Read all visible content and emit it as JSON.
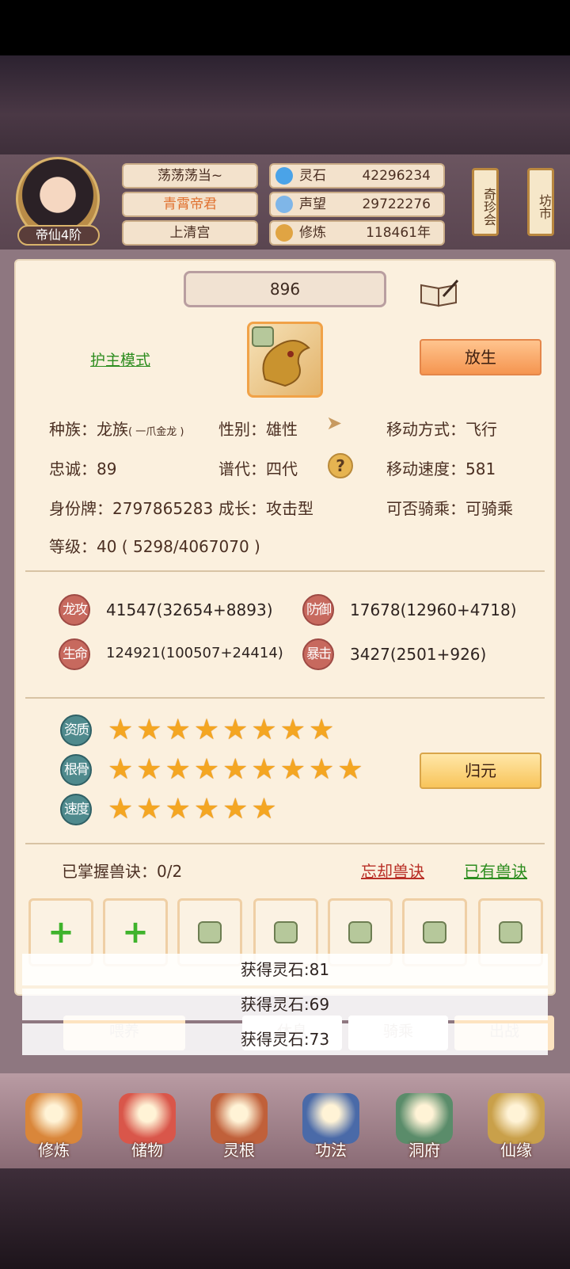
{
  "header": {
    "avatar_level": "帝仙4阶",
    "player_name": "荡荡荡当~",
    "player_title": "青霄帝君",
    "sect": "上清宫",
    "resources": [
      {
        "icon": "spirit-stone-icon",
        "label": "灵石",
        "value": "42296234"
      },
      {
        "icon": "reputation-icon",
        "label": "声望",
        "value": "29722276"
      },
      {
        "icon": "cultivation-icon",
        "label": "修炼",
        "value": "118461年"
      }
    ],
    "side_buttons": [
      {
        "label": "奇珍会"
      },
      {
        "label": "坊市"
      }
    ]
  },
  "pet": {
    "number": "896",
    "guard_mode_label": "护主模式",
    "release_label": "放生",
    "race_label": "种族：龙族",
    "race_sub": "( 一爪金龙 )",
    "gender": "性别：雄性",
    "movement": "移动方式：飞行",
    "loyalty": "忠诚：89",
    "generation": "谱代：四代",
    "move_speed": "移动速度：581",
    "id_tag": "身份牌：2797865283",
    "growth": "成长：攻击型",
    "rideable": "可否骑乘：可骑乘",
    "level": "等级：40 ( 5298/4067070 )"
  },
  "stats": [
    {
      "badge": "龙攻",
      "value": "41547(32654+8893)"
    },
    {
      "badge": "防御",
      "value": "17678(12960+4718)"
    },
    {
      "badge": "生命",
      "value": "124921(100507+24414)"
    },
    {
      "badge": "暴击",
      "value": "3427(2501+926)"
    }
  ],
  "aptitude": {
    "rows": [
      {
        "badge": "资质",
        "stars": 8
      },
      {
        "badge": "根骨",
        "stars": 9
      },
      {
        "badge": "速度",
        "stars": 6
      }
    ],
    "restore_label": "归元"
  },
  "skills": {
    "mastered": "已掌握兽诀：0/2",
    "forget_label": "忘却兽诀",
    "owned_label": "已有兽诀"
  },
  "gains": [
    "获得灵石:81",
    "获得灵石:69",
    "获得灵石:73"
  ],
  "actions": [
    "喂养",
    "休息",
    "骑乘",
    "出战"
  ],
  "nav": [
    {
      "label": "修炼",
      "color": "#d9863a"
    },
    {
      "label": "储物",
      "color": "#d9564a"
    },
    {
      "label": "灵根",
      "color": "#c0603a"
    },
    {
      "label": "功法",
      "color": "#4a6aa8"
    },
    {
      "label": "洞府",
      "color": "#5a8c6a"
    },
    {
      "label": "仙缘",
      "color": "#c9a04a"
    }
  ],
  "colors": {
    "panel": "#fbf0de",
    "accent_orange": "#f59550",
    "star": "#f4a622"
  }
}
